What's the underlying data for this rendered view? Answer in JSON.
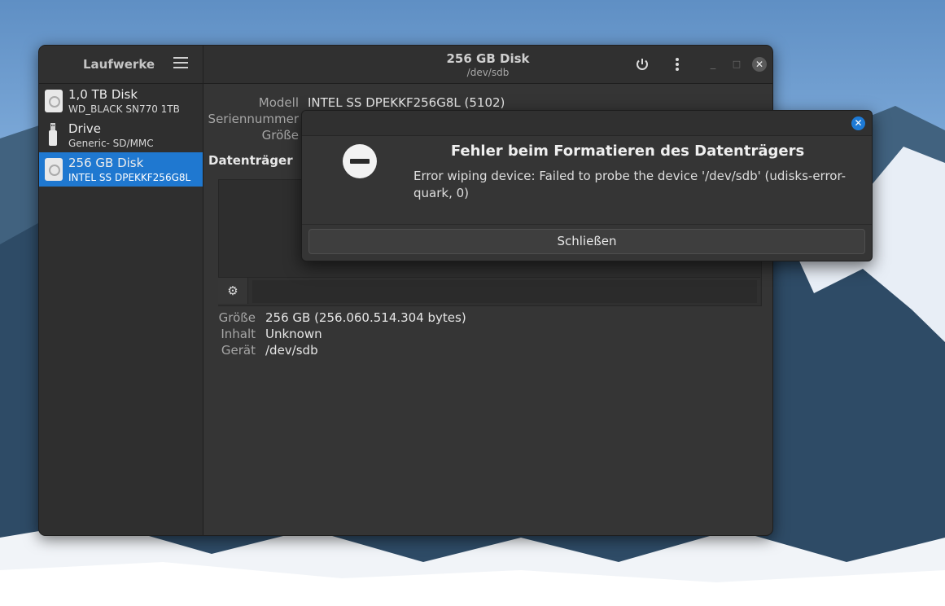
{
  "sidebar": {
    "title": "Laufwerke",
    "drives": [
      {
        "name": "1,0 TB Disk",
        "detail": "WD_BLACK SN770 1TB",
        "icon": "disk-icon"
      },
      {
        "name": "Drive",
        "detail": "Generic- SD/MMC",
        "icon": "usb-drive-icon"
      },
      {
        "name": "256 GB Disk",
        "detail": "INTEL SS DPEKKF256G8L",
        "icon": "disk-icon"
      }
    ]
  },
  "header": {
    "title": "256 GB Disk",
    "subtitle": "/dev/sdb"
  },
  "info": {
    "model_label": "Modell",
    "model_value": "INTEL SS DPEKKF256G8L (5102)",
    "serial_label": "Seriennummer",
    "size_label": "Größe",
    "section_title": "Datenträger"
  },
  "volume": {
    "size_label": "Größe",
    "size_value": "256 GB (256.060.514.304 bytes)",
    "content_label": "Inhalt",
    "content_value": "Unknown",
    "device_label": "Gerät",
    "device_value": "/dev/sdb"
  },
  "dialog": {
    "title": "Fehler beim Formatieren des Datenträgers",
    "message": "Error wiping device: Failed to probe the device '/dev/sdb' (udisks-error-quark, 0)",
    "button": "Schließen"
  },
  "colors": {
    "accent": "#1f78d0",
    "window_bg": "#353535"
  }
}
